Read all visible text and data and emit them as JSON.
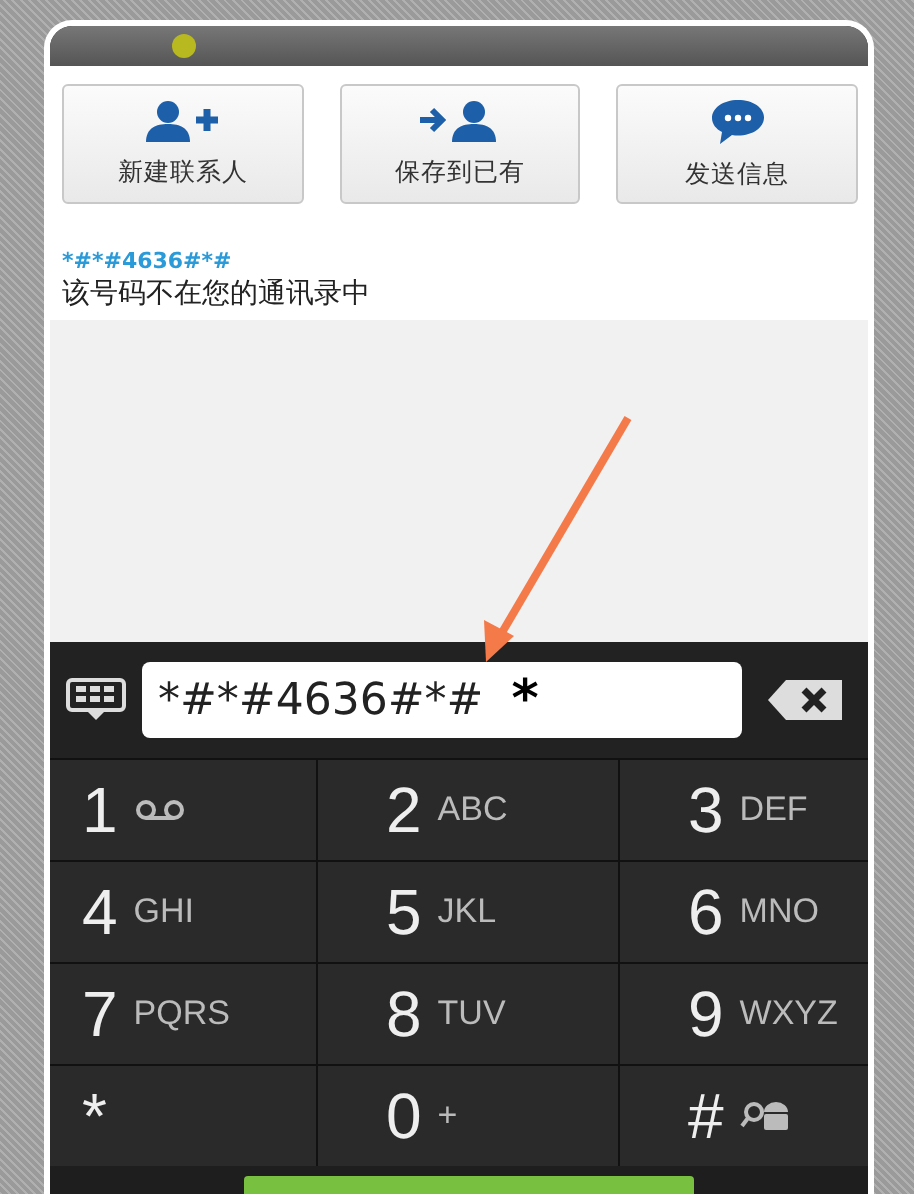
{
  "actions": [
    {
      "label": "新建联系人",
      "kind": "add-person"
    },
    {
      "label": "保存到已有",
      "kind": "save-person"
    },
    {
      "label": "发送信息",
      "kind": "message"
    }
  ],
  "number": "*#*#4636#*#",
  "number_note": "该号码不在您的通讯录中",
  "dial_field": {
    "value": "*#*#4636#*#",
    "pressed_key": "*"
  },
  "keys": [
    {
      "digit": "1",
      "kind": "voicemail"
    },
    {
      "digit": "2",
      "letters": "ABC",
      "kind": "letters"
    },
    {
      "digit": "3",
      "letters": "DEF",
      "kind": "letters"
    },
    {
      "digit": "4",
      "letters": "GHI",
      "kind": "letters"
    },
    {
      "digit": "5",
      "letters": "JKL",
      "kind": "letters"
    },
    {
      "digit": "6",
      "letters": "MNO",
      "kind": "letters"
    },
    {
      "digit": "7",
      "letters": "PQRS",
      "kind": "letters"
    },
    {
      "digit": "8",
      "letters": "TUV",
      "kind": "letters"
    },
    {
      "digit": "9",
      "letters": "WXYZ",
      "kind": "letters"
    },
    {
      "digit": "*",
      "kind": "none"
    },
    {
      "digit": "0",
      "letters": "+",
      "kind": "letters"
    },
    {
      "digit": "#",
      "kind": "search"
    }
  ]
}
